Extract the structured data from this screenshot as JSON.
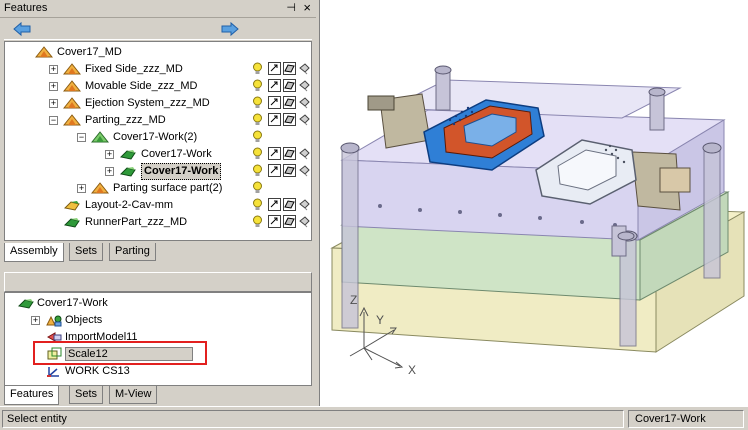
{
  "features_panel": {
    "title": "Features",
    "pin_glyph": "⊣",
    "close_glyph": "×"
  },
  "assembly_tree": [
    {
      "label": "Cover17_MD",
      "icon": "assembly-icon",
      "indent": 0,
      "expander": "",
      "status": false
    },
    {
      "label": "Fixed Side_zzz_MD",
      "icon": "assembly-icon",
      "indent": 1,
      "expander": "+",
      "status": true
    },
    {
      "label": "Movable Side_zzz_MD",
      "icon": "assembly-icon",
      "indent": 1,
      "expander": "+",
      "status": true
    },
    {
      "label": "Ejection System_zzz_MD",
      "icon": "assembly-icon",
      "indent": 1,
      "expander": "+",
      "status": true
    },
    {
      "label": "Parting_zzz_MD",
      "icon": "assembly-icon",
      "indent": 1,
      "expander": "−",
      "status": true
    },
    {
      "label": "Cover17-Work(2)",
      "icon": "assembly-green-icon",
      "indent": 2,
      "expander": "−",
      "status": false
    },
    {
      "label": "Cover17-Work",
      "icon": "part-green-icon",
      "indent": 3,
      "expander": "+",
      "status": true
    },
    {
      "label": "Cover17-Work",
      "icon": "part-green-icon",
      "indent": 3,
      "expander": "+",
      "status": true,
      "selected": true
    },
    {
      "label": "Parting surface part(2)",
      "icon": "assembly-icon",
      "indent": 2,
      "expander": "+",
      "status": false
    },
    {
      "label": "Layout-2-Cav-mm",
      "icon": "layout-icon",
      "indent": 1,
      "expander": "",
      "status": true
    },
    {
      "label": "RunnerPart_zzz_MD",
      "icon": "part-green-icon",
      "indent": 1,
      "expander": "",
      "status": true
    }
  ],
  "top_tabs": [
    "Assembly",
    "Sets",
    "Parting"
  ],
  "lower_tree": [
    {
      "label": "Cover17-Work",
      "icon": "part-green-icon",
      "indent": 0,
      "expander": ""
    },
    {
      "label": "Objects",
      "icon": "objects-icon",
      "indent": 1,
      "expander": "+"
    },
    {
      "label": "ImportModel11",
      "icon": "import-icon",
      "indent": 1,
      "expander": ""
    },
    {
      "label": "Scale12",
      "icon": "scale-icon",
      "indent": 1,
      "expander": "",
      "selected": true
    },
    {
      "label": "WORK CS13",
      "icon": "csys-icon",
      "indent": 1,
      "expander": ""
    }
  ],
  "bottom_tabs": [
    "Features",
    "Sets",
    "M-View"
  ],
  "viewport": {
    "axis_z": "Z",
    "axis_y": "Y",
    "axis_x": "X"
  },
  "status_bar": {
    "message": "Select entity",
    "current_part": "Cover17-Work"
  },
  "colors": {
    "highlight": "#e2201f",
    "panel": "#d4d0c8",
    "mold_plate": "#d8d4f0",
    "part_blue": "#2f7fd6",
    "part_orange": "#d2552a"
  }
}
